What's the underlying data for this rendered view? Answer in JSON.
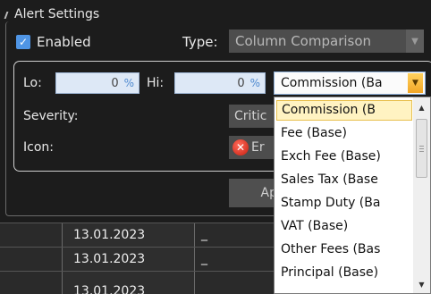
{
  "alert_settings": {
    "group_title": "Alert Settings",
    "enabled": {
      "label": "Enabled",
      "checked": true
    },
    "type": {
      "label": "Type:",
      "value": "Column Comparison"
    },
    "lo": {
      "label": "Lo:",
      "value": "0",
      "unit": "%"
    },
    "hi": {
      "label": "Hi:",
      "value": "0",
      "unit": "%"
    },
    "column": {
      "value": "Commission (Ba"
    },
    "severity": {
      "label": "Severity:",
      "value": "Critic"
    },
    "icon": {
      "label": "Icon:",
      "value": "Er",
      "icon_name": "error-icon"
    },
    "apply_button": "Ap"
  },
  "dropdown": {
    "selected_index": 0,
    "options": [
      "Commission (B",
      "Fee (Base)",
      "Exch Fee (Base)",
      "Sales Tax (Base",
      "Stamp Duty (Ba",
      "VAT (Base)",
      "Other Fees (Bas",
      "Principal (Base)"
    ]
  },
  "grid": {
    "rows": [
      {
        "date": "13.01.2023",
        "value": "_"
      },
      {
        "date": "13.01.2023",
        "value": "_"
      },
      {
        "date": "13.01.2023",
        "value": ""
      }
    ]
  },
  "colors": {
    "accent": "#4f95e5",
    "panel_bg": "#1c1c1c",
    "dropdown_highlight": "#fff3c2"
  }
}
